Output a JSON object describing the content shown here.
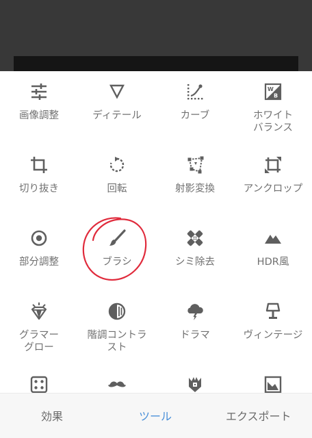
{
  "tools": [
    {
      "label": "画像調整",
      "icon": "tune-sliders-icon"
    },
    {
      "label": "ディテール",
      "icon": "details-triangle-icon"
    },
    {
      "label": "カーブ",
      "icon": "curves-icon"
    },
    {
      "label": "ホワイト\nバランス",
      "icon": "white-balance-icon"
    },
    {
      "label": "切り抜き",
      "icon": "crop-icon"
    },
    {
      "label": "回転",
      "icon": "rotate-icon"
    },
    {
      "label": "射影変換",
      "icon": "perspective-icon"
    },
    {
      "label": "アンクロップ",
      "icon": "expand-icon"
    },
    {
      "label": "部分調整",
      "icon": "selective-target-icon"
    },
    {
      "label": "ブラシ",
      "icon": "brush-icon"
    },
    {
      "label": "シミ除去",
      "icon": "healing-bandage-icon"
    },
    {
      "label": "HDR風",
      "icon": "hdr-mountains-icon"
    },
    {
      "label": "グラマー\nグロー",
      "icon": "glamour-diamond-icon"
    },
    {
      "label": "階調コントラ\nスト",
      "icon": "tonal-contrast-icon"
    },
    {
      "label": "ドラマ",
      "icon": "drama-cloud-icon"
    },
    {
      "label": "ヴィンテージ",
      "icon": "vintage-lamp-icon"
    },
    {
      "label": "",
      "icon": "grainy-film-dice-icon"
    },
    {
      "label": "",
      "icon": "mustache-icon"
    },
    {
      "label": "",
      "icon": "grunge-guitar-icon"
    },
    {
      "label": "",
      "icon": "frames-icon"
    }
  ],
  "bottom_nav": {
    "effects": "効果",
    "tools": "ツール",
    "export": "エクスポート",
    "active_color": "#4a90d9",
    "inactive_color": "#6a6a6a"
  },
  "annotation_color": "#e02b3c"
}
